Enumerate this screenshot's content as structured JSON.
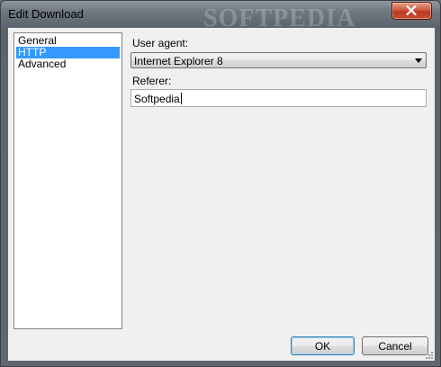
{
  "window": {
    "title": "Edit Download",
    "watermark": "SOFTPEDIA"
  },
  "nav": {
    "items": [
      {
        "label": "General",
        "selected": false
      },
      {
        "label": "HTTP",
        "selected": true
      },
      {
        "label": "Advanced",
        "selected": false
      }
    ]
  },
  "form": {
    "user_agent_label": "User agent:",
    "user_agent_value": "Internet Explorer 8",
    "referer_label": "Referer:",
    "referer_value": "Softpedia"
  },
  "buttons": {
    "ok": "OK",
    "cancel": "Cancel"
  },
  "icons": {
    "close": "close-icon",
    "dropdown": "chevron-down-icon",
    "resize": "resize-grip-icon"
  },
  "colors": {
    "selection": "#3399ff",
    "close_button": "#c9502f"
  }
}
